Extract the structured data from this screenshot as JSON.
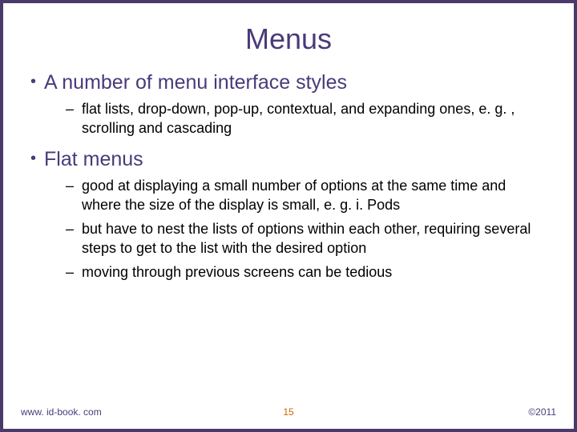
{
  "title": "Menus",
  "bullets": [
    {
      "text": "A number of menu interface styles",
      "sub": [
        "flat lists, drop-down, pop-up, contextual, and expanding ones, e. g. , scrolling and cascading"
      ]
    },
    {
      "text": "Flat menus",
      "sub": [
        "good at displaying a small number of options at the same time and where the size of the display is small, e. g. i. Pods",
        "but have to nest the lists of options within each other, requiring several steps to get to the list with the desired option",
        "moving through previous screens can be tedious"
      ]
    }
  ],
  "footer": {
    "left": "www. id-book. com",
    "center": "15",
    "right": "©2011"
  }
}
